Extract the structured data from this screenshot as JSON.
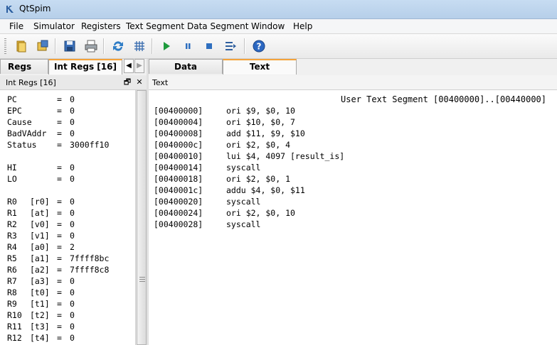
{
  "window": {
    "title": "QtSpim"
  },
  "menu": [
    "File",
    "Simulator",
    "Registers",
    "Text Segment",
    "Data Segment",
    "Window",
    "Help"
  ],
  "toolbar": {
    "buttons": [
      "open-folder",
      "save-as",
      "save",
      "print",
      "reinitialize",
      "clear-grid",
      "run",
      "pause",
      "stop",
      "single-step",
      "help"
    ]
  },
  "left_tabs": {
    "fp_regs": "Regs",
    "int_regs": "Int Regs [16]"
  },
  "int_regs_panel": {
    "title": "Int Regs [16]"
  },
  "registers": {
    "special": [
      {
        "name": "PC",
        "value": "0"
      },
      {
        "name": "EPC",
        "value": "0"
      },
      {
        "name": "Cause",
        "value": "0"
      },
      {
        "name": "BadVAddr",
        "value": "0"
      },
      {
        "name": "Status",
        "value": "3000ff10"
      }
    ],
    "hilo": [
      {
        "name": "HI",
        "value": "0"
      },
      {
        "name": "LO",
        "value": "0"
      }
    ],
    "general": [
      {
        "num": "R0",
        "alias": "[r0]",
        "value": "0"
      },
      {
        "num": "R1",
        "alias": "[at]",
        "value": "0"
      },
      {
        "num": "R2",
        "alias": "[v0]",
        "value": "0"
      },
      {
        "num": "R3",
        "alias": "[v1]",
        "value": "0"
      },
      {
        "num": "R4",
        "alias": "[a0]",
        "value": "2"
      },
      {
        "num": "R5",
        "alias": "[a1]",
        "value": "7ffff8bc"
      },
      {
        "num": "R6",
        "alias": "[a2]",
        "value": "7ffff8c8"
      },
      {
        "num": "R7",
        "alias": "[a3]",
        "value": "0"
      },
      {
        "num": "R8",
        "alias": "[t0]",
        "value": "0"
      },
      {
        "num": "R9",
        "alias": "[t1]",
        "value": "0"
      },
      {
        "num": "R10",
        "alias": "[t2]",
        "value": "0"
      },
      {
        "num": "R11",
        "alias": "[t3]",
        "value": "0"
      },
      {
        "num": "R12",
        "alias": "[t4]",
        "value": "0"
      }
    ]
  },
  "right_tabs": {
    "data": "Data",
    "text": "Text"
  },
  "text_panel": {
    "title": "Text",
    "header": "User Text Segment [00400000]..[00440000]",
    "lines": [
      {
        "addr": "[00400000]",
        "instr": "ori $9, $0, 10"
      },
      {
        "addr": "[00400004]",
        "instr": "ori $10, $0, 7"
      },
      {
        "addr": "[00400008]",
        "instr": "add $11, $9, $10"
      },
      {
        "addr": "[0040000c]",
        "instr": "ori $2, $0, 4"
      },
      {
        "addr": "[00400010]",
        "instr": "lui $4, 4097 [result_is]"
      },
      {
        "addr": "[00400014]",
        "instr": "syscall"
      },
      {
        "addr": "[00400018]",
        "instr": "ori $2, $0, 1"
      },
      {
        "addr": "[0040001c]",
        "instr": "addu $4, $0, $11"
      },
      {
        "addr": "[00400020]",
        "instr": "syscall"
      },
      {
        "addr": "[00400024]",
        "instr": "ori $2, $0, 10"
      },
      {
        "addr": "[00400028]",
        "instr": "syscall"
      }
    ]
  },
  "colors": {
    "active_tab_accent": "#f5a33a",
    "title_bar": "#c7dcf2"
  }
}
